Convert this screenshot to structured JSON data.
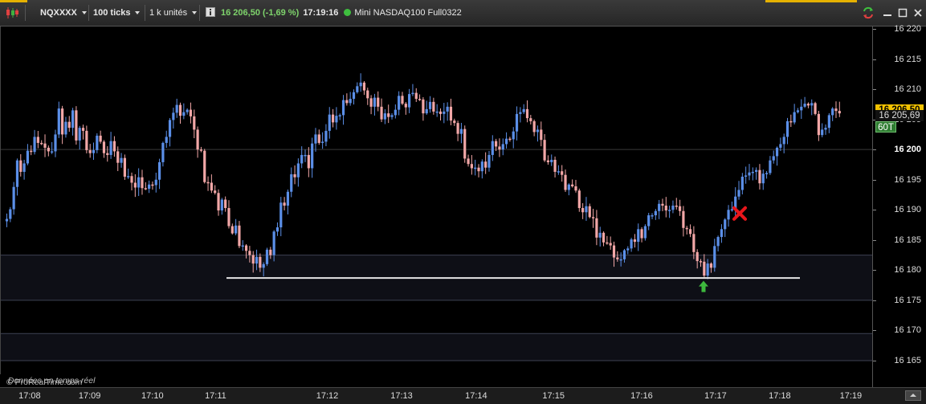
{
  "toolbar": {
    "symbol": "NQXXXX",
    "period": "100 ticks",
    "quantity": "1 k unités",
    "price": "16 206,50",
    "change": "(-1,69 %)",
    "time": "17:19:16",
    "instrument": "Mini NASDAQ100 Full0322",
    "icons": [
      "candlestick-icon",
      "info-icon",
      "status-dot-icon",
      "refresh-icon",
      "minimize-icon",
      "restore-icon",
      "close-icon"
    ]
  },
  "footer": {
    "brand": "© ProRealTime.com",
    "status": "Données en temps réel"
  },
  "y_axis": {
    "labels": [
      "16 220",
      "16 215",
      "16 210",
      "16 205",
      "16 200",
      "16 195",
      "16 190",
      "16 185",
      "16 180",
      "16 175",
      "16 170",
      "16 165"
    ],
    "values": [
      16220,
      16215,
      16210,
      16205,
      16200,
      16195,
      16190,
      16185,
      16180,
      16175,
      16170,
      16165
    ],
    "min": 16162,
    "max": 16222
  },
  "badges": {
    "last_price": {
      "text": "16 206,50",
      "value": 16206.5,
      "bg": "#f2c200",
      "fg": "#000000"
    },
    "average": {
      "text": "16 205,69",
      "value": 16205.69,
      "bg": "#111111",
      "fg": "#dddddd"
    },
    "period_tag": {
      "text": "60T",
      "bg": "#2f7d32",
      "fg": "#ffffff"
    },
    "bold_level": {
      "text": "16 200",
      "value": 16200
    }
  },
  "x_axis": {
    "labels": [
      "17:08",
      "17:09",
      "17:10",
      "17:11",
      "17:12",
      "17:13",
      "17:14",
      "17:15",
      "17:16",
      "17:17",
      "17:18",
      "17:19"
    ],
    "bar_index": [
      6.8,
      24.1,
      42.2,
      60.4,
      92.6,
      114.0,
      135.5,
      157.8,
      183.2,
      204.5,
      223.0,
      243.5
    ]
  },
  "chart_data": {
    "type": "candlestick",
    "colors": {
      "up": "#5b8fe8",
      "down": "#f2a7a7",
      "background": "#000000",
      "zone": "#0e0f16"
    },
    "zones": [
      [
        16175,
        16182.5
      ],
      [
        16165,
        16169.5
      ]
    ],
    "reference_lines": [
      16200
    ],
    "support_line": {
      "value": 16178.7,
      "from_bar": 68,
      "to_bar": 242
    },
    "markers": [
      {
        "type": "buy-arrow",
        "bar": 213.5,
        "value": 16177.3,
        "color": "#3db83d"
      },
      {
        "type": "exit-cross",
        "bar": 224.5,
        "value": 16189.4,
        "color": "#e8161b"
      }
    ],
    "closes": [
      16188.5,
      16190.1,
      16193.8,
      16198.2,
      16196.3,
      16197.7,
      16199.8,
      16199.6,
      16202.1,
      16201.1,
      16201.0,
      16200.3,
      16199.7,
      16199.7,
      16202.5,
      16206.8,
      16202.5,
      16204.6,
      16203.6,
      16206.5,
      16201.5,
      16203.6,
      16203.1,
      16199.9,
      16199.4,
      16199.9,
      16202.3,
      16201.3,
      16199.4,
      16199.1,
      16201.4,
      16199.7,
      16197.8,
      16198.6,
      16195.5,
      16195.6,
      16194.5,
      16193.7,
      16195.4,
      16193.6,
      16193.5,
      16194.2,
      16194.1,
      16195.0,
      16197.9,
      16201.1,
      16202.1,
      16204.9,
      16206.1,
      16207.4,
      16205.6,
      16206.2,
      16206.6,
      16205.5,
      16203.3,
      16200.0,
      16199.8,
      16194.6,
      16194.5,
      16193.2,
      16192.8,
      16189.9,
      16191.7,
      16190.3,
      16187.3,
      16186.1,
      16187.4,
      16184.0,
      16184.1,
      16183.2,
      16182.5,
      16181.1,
      16182.2,
      16180.4,
      16181.0,
      16183.4,
      16182.5,
      16186.4,
      16187.1,
      16191.2,
      16190.7,
      16193.0,
      16195.9,
      16195.4,
      16197.7,
      16199.1,
      16199.1,
      16196.9,
      16201.0,
      16202.5,
      16201.1,
      16201.3,
      16203.1,
      16205.8,
      16204.5,
      16205.6,
      16205.7,
      16208.2,
      16207.7,
      16208.4,
      16209.5,
      16210.5,
      16211.1,
      16209.8,
      16208.5,
      16207.1,
      16208.6,
      16207.1,
      16205.0,
      16206.0,
      16205.4,
      16205.7,
      16206.6,
      16208.9,
      16207.6,
      16207.0,
      16209.2,
      16209.4,
      16208.4,
      16208.3,
      16206.0,
      16206.7,
      16207.9,
      16206.3,
      16206.3,
      16205.9,
      16206.3,
      16207.1,
      16204.8,
      16204.4,
      16202.6,
      16203.4,
      16198.5,
      16197.6,
      16196.9,
      16197.0,
      16196.4,
      16198.0,
      16197.0,
      16199.1,
      16201.4,
      16200.5,
      16200.0,
      16200.9,
      16201.8,
      16201.7,
      16203.0,
      16205.9,
      16206.2,
      16206.7,
      16205.2,
      16204.7,
      16202.9,
      16203.3,
      16201.6,
      16198.2,
      16197.9,
      16198.3,
      16196.3,
      16196.4,
      16195.8,
      16193.3,
      16194.2,
      16193.9,
      16193.2,
      16190.3,
      16189.6,
      16190.6,
      16188.8,
      16188.6,
      16185.4,
      16186.2,
      16184.6,
      16184.5,
      16184.1,
      16182.1,
      16181.8,
      16181.8,
      16183.3,
      16183.6,
      16185.1,
      16184.7,
      16186.8,
      16185.3,
      16187.3,
      16189.1,
      16189.1,
      16189.8,
      16191.0,
      16190.7,
      16189.9,
      16190.0,
      16190.7,
      16190.6,
      16189.8,
      16187.0,
      16186.8,
      16186.0,
      16183.0,
      16181.5,
      16181.4,
      16179.1,
      16181.1,
      16180.4,
      16184.0,
      16185.5,
      16186.8,
      16188.4,
      16190.0,
      16190.1,
      16192.2,
      16193.3,
      16195.5,
      16195.7,
      16196.2,
      16196.3,
      16196.6,
      16194.4,
      16196.0,
      16196.1,
      16198.2,
      16198.9,
      16200.3,
      16200.9,
      16202.1,
      16204.7,
      16204.5,
      16206.2,
      16206.5,
      16207.1,
      16207.6,
      16207.3,
      16207.7,
      16205.9,
      16202.4,
      16203.3,
      16203.6,
      16205.7,
      16206.8,
      16206.4,
      16206.0
    ]
  }
}
